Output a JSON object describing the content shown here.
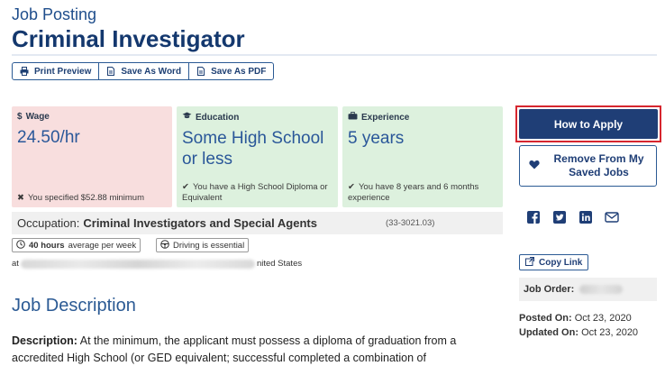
{
  "header": {
    "kicker": "Job Posting",
    "title": "Criminal Investigator"
  },
  "toolbar": {
    "print_label": "Print Preview",
    "word_label": "Save As Word",
    "pdf_label": "Save As PDF"
  },
  "cards": {
    "wage": {
      "label": "Wage",
      "value": "24.50/hr",
      "note": "You specified $52.88 minimum",
      "note_mark": "✖"
    },
    "education": {
      "label": "Education",
      "value": "Some High School or less",
      "note": "You have a High School Diploma or Equivalent",
      "note_mark": "✔"
    },
    "experience": {
      "label": "Experience",
      "value": "5 years",
      "note": "You have 8 years and 6 months experience",
      "note_mark": "✔"
    }
  },
  "occupation": {
    "label": "Occupation:",
    "value": "Criminal Investigators and Special Agents",
    "code": "(33-3021.03)"
  },
  "pills": {
    "hours_bold": "40 hours",
    "hours_rest": "average per week",
    "driving": "Driving is essential"
  },
  "location": {
    "prefix": "at",
    "suffix": "nited States"
  },
  "description": {
    "heading": "Job Description",
    "label": "Description:",
    "text": "At the minimum, the applicant must possess a diploma of graduation from a accredited High School (or GED equivalent; successful completed a combination of"
  },
  "sidebar": {
    "apply_label": "How to Apply",
    "save_label": "Remove From My Saved Jobs",
    "copy_link_label": "Copy Link",
    "job_order_label": "Job Order:",
    "posted_label": "Posted On:",
    "posted_value": "Oct 23, 2020",
    "updated_label": "Updated On:",
    "updated_value": "Oct 23, 2020"
  },
  "colors": {
    "brand": "#1f3e76",
    "highlight": "#d6262f",
    "wage_bg": "#f8dede",
    "match_bg": "#ddf1de"
  },
  "icons": {
    "print": "printer-icon",
    "word": "document-icon",
    "pdf": "document-icon",
    "wage": "dollar-icon",
    "education": "graduation-cap-icon",
    "experience": "briefcase-icon",
    "hours": "clock-icon",
    "driving": "steering-wheel-icon",
    "save": "heart-icon",
    "social": [
      "facebook-icon",
      "twitter-icon",
      "linkedin-icon",
      "email-icon"
    ],
    "copy": "external-link-icon"
  }
}
